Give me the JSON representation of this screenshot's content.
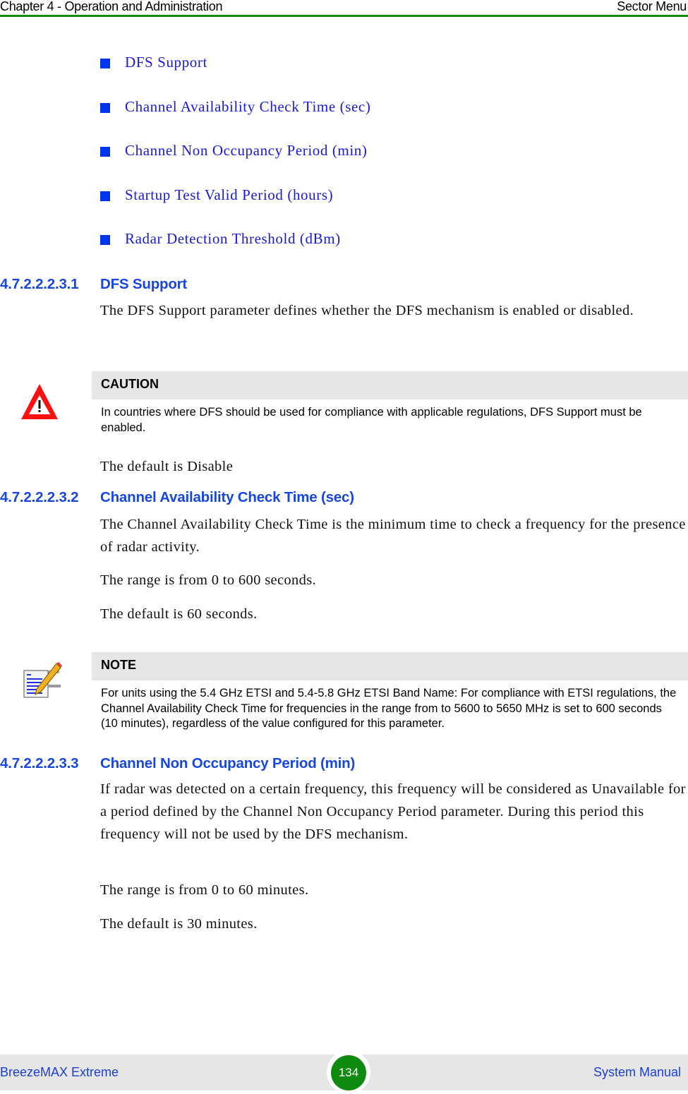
{
  "header": {
    "chapter": "Chapter 4 - Operation and Administration",
    "section": "Sector Menu",
    "rule_color": "#118a11"
  },
  "bullets": [
    {
      "label": "DFS Support"
    },
    {
      "label": "Channel Availability Check Time (sec)"
    },
    {
      "label": "Channel Non Occupancy Period (min)"
    },
    {
      "label": "Startup Test Valid Period (hours)"
    },
    {
      "label": "Radar Detection Threshold (dBm)"
    }
  ],
  "sections": [
    {
      "number": "4.7.2.2.2.3.1",
      "title": "DFS Support",
      "paragraphs": [
        "The DFS Support parameter defines whether the DFS mechanism is enabled or disabled."
      ],
      "callout": {
        "type": "caution",
        "icon": "warning-triangle-icon",
        "title": "CAUTION",
        "text": "In countries where DFS should be used for compliance with applicable regulations, DFS Support must be enabled."
      },
      "after_callout": [
        "The default is Disable"
      ]
    },
    {
      "number": "4.7.2.2.2.3.2",
      "title": "Channel Availability Check Time (sec)",
      "paragraphs": [
        "The Channel Availability Check Time is the minimum time to check a frequency for the presence of radar activity.",
        "The range is from 0 to 600 seconds.",
        "The default is 60 seconds."
      ],
      "callout": {
        "type": "note",
        "icon": "note-pencil-icon",
        "title": "NOTE",
        "text": "For units using the 5.4 GHz ETSI and 5.4-5.8 GHz ETSI Band Name: For compliance with ETSI regulations, the Channel Availability Check Time for frequencies in the range from to 5600 to 5650 MHz is set to 600 seconds (10 minutes), regardless of the value configured for this parameter."
      }
    },
    {
      "number": "4.7.2.2.2.3.3",
      "title": "Channel Non Occupancy Period (min)",
      "paragraphs": [
        "If radar was detected on a certain frequency, this frequency will be considered as Unavailable for a period defined by the Channel Non Occupancy Period parameter. During this period this frequency will not be used by the DFS mechanism.",
        "The range is from 0 to 60 minutes.",
        "The default is 30 minutes."
      ]
    }
  ],
  "footer": {
    "product": "BreezeMAX Extreme",
    "page_number": "134",
    "doc_type": "System Manual",
    "badge_color": "#0e8a0e"
  }
}
